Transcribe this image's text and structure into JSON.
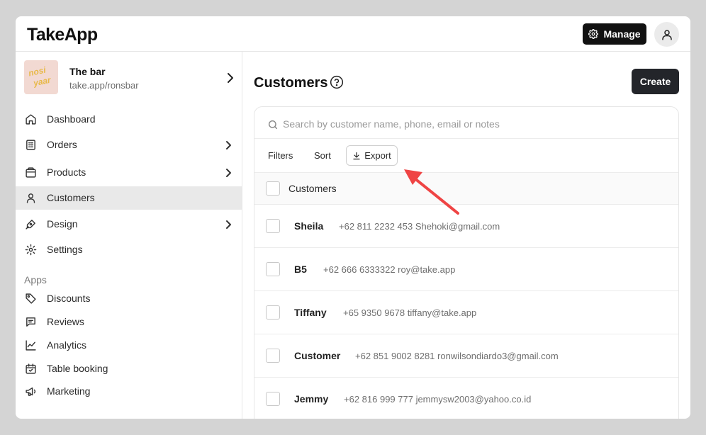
{
  "app": {
    "logo": "TakeApp"
  },
  "topbar": {
    "manage_label": "Manage"
  },
  "store": {
    "name": "The bar",
    "url": "take.app/ronsbar",
    "thumb_text_1": "nosi",
    "thumb_text_2": "yaar"
  },
  "nav": {
    "items": [
      {
        "label": "Dashboard",
        "icon": "home-icon"
      },
      {
        "label": "Orders",
        "icon": "receipt-icon"
      },
      {
        "label": "Products",
        "icon": "box-icon"
      },
      {
        "label": "Customers",
        "icon": "user-icon",
        "active": true
      },
      {
        "label": "Design",
        "icon": "pen-icon"
      },
      {
        "label": "Settings",
        "icon": "gear-icon"
      }
    ],
    "apps_label": "Apps",
    "apps": [
      {
        "label": "Discounts",
        "icon": "tag-icon"
      },
      {
        "label": "Reviews",
        "icon": "message-icon"
      },
      {
        "label": "Analytics",
        "icon": "chart-line-icon"
      },
      {
        "label": "Table booking",
        "icon": "calendar-check-icon"
      },
      {
        "label": "Marketing",
        "icon": "megaphone-icon"
      }
    ]
  },
  "main": {
    "title": "Customers",
    "create_label": "Create",
    "search_placeholder": "Search by customer name, phone, email or notes",
    "tools": {
      "filters": "Filters",
      "sort": "Sort",
      "export": "Export"
    },
    "table_header": "Customers",
    "customers": [
      {
        "name": "Sheila",
        "details": "+62 811 2232 453 Shehoki@gmail.com"
      },
      {
        "name": "B5",
        "details": "+62 666 6333322 roy@take.app"
      },
      {
        "name": "Tiffany",
        "details": "+65 9350 9678 tiffany@take.app"
      },
      {
        "name": "Customer",
        "details": "+62 851 9002 8281 ronwilsondiardo3@gmail.com"
      },
      {
        "name": "Jemmy",
        "details": "+62 816 999 777 jemmysw2003@yahoo.co.id"
      }
    ]
  },
  "colors": {
    "accent_dark": "#111111",
    "annotation_arrow": "#ef4444"
  }
}
